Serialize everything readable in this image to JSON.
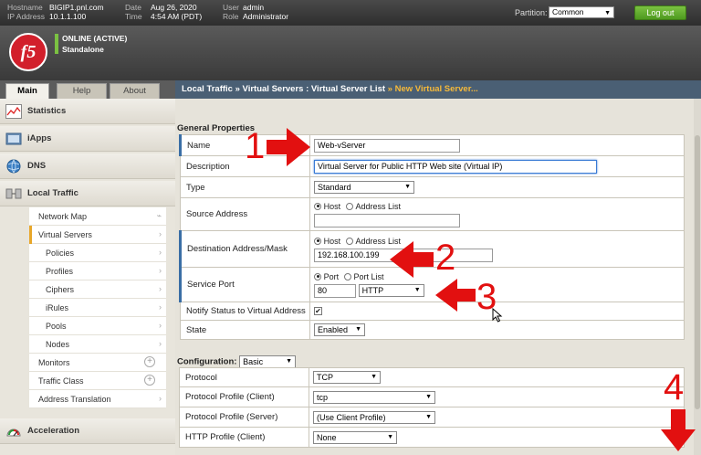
{
  "topbar": {
    "hostname_label": "Hostname",
    "hostname": "BIGIP1.pnl.com",
    "ip_label": "IP Address",
    "ip": "10.1.1.100",
    "date_label": "Date",
    "date": "Aug 26, 2020",
    "time_label": "Time",
    "time": "4:54 AM (PDT)",
    "user_label": "User",
    "user": "admin",
    "role_label": "Role",
    "role": "Administrator",
    "partition_label": "Partition:",
    "partition_value": "Common",
    "logout_label": "Log out"
  },
  "header": {
    "logo_text": "f5",
    "status_line1": "ONLINE (ACTIVE)",
    "status_line2": "Standalone"
  },
  "tabs": [
    {
      "label": "Main",
      "active": true
    },
    {
      "label": "Help",
      "active": false
    },
    {
      "label": "About",
      "active": false
    }
  ],
  "sidebar": {
    "items": [
      {
        "label": "Statistics",
        "icon": "statistics-icon"
      },
      {
        "label": "iApps",
        "icon": "iapps-icon"
      },
      {
        "label": "DNS",
        "icon": "dns-globe-icon"
      },
      {
        "label": "Local Traffic",
        "icon": "local-traffic-icon"
      }
    ],
    "subitems": [
      {
        "label": "Network Map",
        "indent": 0
      },
      {
        "label": "Virtual Servers",
        "indent": 0,
        "active": true
      },
      {
        "label": "Policies",
        "indent": 1
      },
      {
        "label": "Profiles",
        "indent": 1
      },
      {
        "label": "Ciphers",
        "indent": 1
      },
      {
        "label": "iRules",
        "indent": 1
      },
      {
        "label": "Pools",
        "indent": 1
      },
      {
        "label": "Nodes",
        "indent": 1
      },
      {
        "label": "Monitors",
        "indent": 0
      },
      {
        "label": "Traffic Class",
        "indent": 0
      },
      {
        "label": "Address Translation",
        "indent": 0
      }
    ],
    "acceleration_label": "Acceleration"
  },
  "breadcrumb": {
    "part1": "Local Traffic",
    "sep": "»",
    "part2": "Virtual Servers : Virtual Server List",
    "current": "New Virtual Server..."
  },
  "general": {
    "title": "General Properties",
    "name_label": "Name",
    "name_value": "Web-vServer",
    "description_label": "Description",
    "description_value": "Virtual Server for Public HTTP Web site (Virtual IP)",
    "type_label": "Type",
    "type_value": "Standard",
    "source_label": "Source Address",
    "host_label": "Host",
    "address_list_label": "Address List",
    "dest_label": "Destination Address/Mask",
    "dest_value": "192.168.100.199",
    "port_label": "Service Port",
    "port_radio_label": "Port",
    "port_list_label": "Port List",
    "port_value": "80",
    "port_protocol": "HTTP",
    "notify_label": "Notify Status to Virtual Address",
    "notify_checked": "✔",
    "state_label": "State",
    "state_value": "Enabled"
  },
  "configuration": {
    "title": "Configuration:",
    "mode": "Basic",
    "protocol_label": "Protocol",
    "protocol_value": "TCP",
    "pp_client_label": "Protocol Profile (Client)",
    "pp_client_value": "tcp",
    "pp_server_label": "Protocol Profile (Server)",
    "pp_server_value": "(Use Client Profile)",
    "http_client_label": "HTTP Profile (Client)",
    "http_client_value": "None"
  },
  "annotations": {
    "n1": "1",
    "n2": "2",
    "n3": "3",
    "n4": "4",
    "color": "#e21010"
  }
}
